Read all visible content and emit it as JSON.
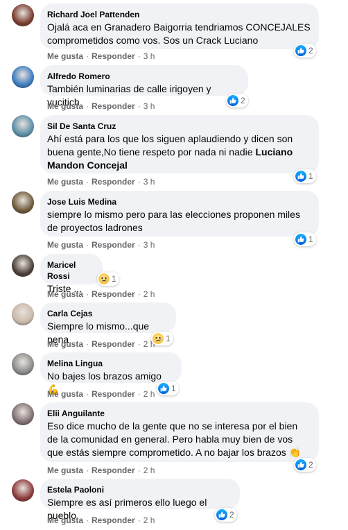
{
  "actions": {
    "like": "Me gusta",
    "reply": "Responder",
    "sep": "·"
  },
  "comments": [
    {
      "author": "Richard Joel Pattenden",
      "text": "Ojalá aca en Granadero Baigorria tendriamos CONCEJALES comprometidos como vos. Sos un Crack Luciano",
      "time": "3 h",
      "reaction": "like",
      "count": "2",
      "avatar_color": "#7a3b2e"
    },
    {
      "author": "Alfredo Romero",
      "text": "También luminarias de calle irigoyen y vucitich",
      "time": "3 h",
      "reaction": "like",
      "count": "2",
      "avatar_color": "#3b7bbf"
    },
    {
      "author": "Sil De Santa Cruz",
      "text": "Ahí está para los que los siguen aplaudiendo y dicen son buena gente,No tiene respeto por nada ni nadie",
      "bold": "Luciano Mandon Concejal",
      "time": "3 h",
      "reaction": "like",
      "count": "1",
      "avatar_color": "#5b8fa8"
    },
    {
      "author": "Jose Luis Medina",
      "text": "siempre lo mismo pero para las elecciones proponen miles de proyectos ladrones",
      "time": "3 h",
      "reaction": "like",
      "count": "1",
      "avatar_color": "#6e5a3a"
    },
    {
      "author": "Maricel Rossi",
      "text": "Triste ...",
      "time": "2 h",
      "reaction": "sad",
      "count": "1",
      "avatar_color": "#4a4038"
    },
    {
      "author": "Carla Cejas",
      "text": "Siempre lo mismo...que pena",
      "time": "2 h",
      "reaction": "sad",
      "count": "1",
      "avatar_color": "#c9b8aa"
    },
    {
      "author": "Melina Lingua",
      "text": "No bajes los brazos amigo",
      "emoji": "💪",
      "time": "2 h",
      "reaction": "like",
      "count": "1",
      "avatar_color": "#8a8a8a"
    },
    {
      "author": "Elii Anguilante",
      "text": "Eso dice mucho de la gente que no se interesa por el bien de la comunidad en general. Pero habla muy bien de vos que estás siempre comprometido. A no bajar los brazos",
      "emoji": "👏",
      "time": "2 h",
      "reaction": "like",
      "count": "2",
      "avatar_color": "#7f6f73"
    },
    {
      "author": "Estela Paoloni",
      "text": "Siempre es así primeros ello luego el pueblo",
      "time": "2 h",
      "reaction": "like",
      "count": "2",
      "avatar_color": "#8b3a3a"
    }
  ]
}
